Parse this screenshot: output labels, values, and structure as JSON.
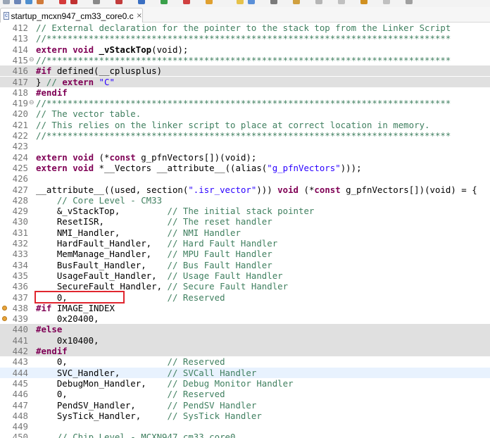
{
  "tab": {
    "label": "startup_mcxn947_cm33_core0.c",
    "close": "×"
  },
  "lines": [
    {
      "n": "412",
      "segs": [
        [
          "cm",
          "// External declaration for the pointer to the stack top from the Linker Script"
        ]
      ]
    },
    {
      "n": "413",
      "segs": [
        [
          "cm",
          "//*****************************************************************************"
        ]
      ]
    },
    {
      "n": "414",
      "segs": [
        [
          "kw",
          "extern void "
        ],
        [
          "fn",
          "_vStackTop"
        ],
        [
          "",
          "(void);"
        ]
      ]
    },
    {
      "n": "415",
      "fold": "⊖",
      "segs": [
        [
          "cm",
          "//*****************************************************************************"
        ]
      ]
    },
    {
      "n": "416",
      "bg": "inactive",
      "segs": [
        [
          "pp",
          "#if "
        ],
        [
          "",
          "defined(__cplusplus)"
        ]
      ]
    },
    {
      "n": "417",
      "bg": "inactive",
      "segs": [
        [
          "",
          "} "
        ],
        [
          "cm",
          "// "
        ],
        [
          "kw",
          "extern "
        ],
        [
          "str",
          "\"C\""
        ]
      ]
    },
    {
      "n": "418",
      "segs": [
        [
          "pp",
          "#endif"
        ]
      ]
    },
    {
      "n": "419",
      "fold": "⊖",
      "segs": [
        [
          "cm",
          "//*****************************************************************************"
        ]
      ]
    },
    {
      "n": "420",
      "segs": [
        [
          "cm",
          "// The vector table."
        ]
      ]
    },
    {
      "n": "421",
      "segs": [
        [
          "cm",
          "// This relies on the linker script to place at correct location in memory."
        ]
      ]
    },
    {
      "n": "422",
      "segs": [
        [
          "cm",
          "//*****************************************************************************"
        ]
      ]
    },
    {
      "n": "423",
      "segs": []
    },
    {
      "n": "424",
      "segs": [
        [
          "kw",
          "extern void "
        ],
        [
          "",
          "(*"
        ],
        [
          "kw",
          "const "
        ],
        [
          "",
          "g_pfnVectors[])(void);"
        ]
      ]
    },
    {
      "n": "425",
      "segs": [
        [
          "kw",
          "extern void "
        ],
        [
          "",
          "*__Vectors __attribute__((alias("
        ],
        [
          "str",
          "\"g_pfnVectors\""
        ],
        [
          "",
          ")));"
        ]
      ]
    },
    {
      "n": "426",
      "segs": []
    },
    {
      "n": "427",
      "segs": [
        [
          "",
          "__attribute__((used, section("
        ],
        [
          "str",
          "\".isr_vector\""
        ],
        [
          "",
          ")))"
        ],
        [
          "kw",
          " void "
        ],
        [
          "",
          "(*"
        ],
        [
          "kw",
          "const "
        ],
        [
          "",
          "g_pfnVectors[])(void) = {"
        ]
      ]
    },
    {
      "n": "428",
      "segs": [
        [
          "",
          "    "
        ],
        [
          "cm",
          "// Core Level - CM33"
        ]
      ]
    },
    {
      "n": "429",
      "segs": [
        [
          "",
          "    &_vStackTop,         "
        ],
        [
          "cm",
          "// The initial stack pointer"
        ]
      ]
    },
    {
      "n": "430",
      "segs": [
        [
          "",
          "    ResetISR,            "
        ],
        [
          "cm",
          "// The reset handler"
        ]
      ]
    },
    {
      "n": "431",
      "segs": [
        [
          "",
          "    NMI_Handler,         "
        ],
        [
          "cm",
          "// NMI Handler"
        ]
      ]
    },
    {
      "n": "432",
      "segs": [
        [
          "",
          "    HardFault_Handler,   "
        ],
        [
          "cm",
          "// Hard Fault Handler"
        ]
      ]
    },
    {
      "n": "433",
      "segs": [
        [
          "",
          "    MemManage_Handler,   "
        ],
        [
          "cm",
          "// MPU Fault Handler"
        ]
      ]
    },
    {
      "n": "434",
      "segs": [
        [
          "",
          "    BusFault_Handler,    "
        ],
        [
          "cm",
          "// Bus Fault Handler"
        ]
      ]
    },
    {
      "n": "435",
      "segs": [
        [
          "",
          "    UsageFault_Handler,  "
        ],
        [
          "cm",
          "// Usage Fault Handler"
        ]
      ]
    },
    {
      "n": "436",
      "segs": [
        [
          "",
          "    SecureFault_Handler, "
        ],
        [
          "cm",
          "// Secure Fault Handler"
        ]
      ]
    },
    {
      "n": "437",
      "segs": [
        [
          "",
          "    0,                   "
        ],
        [
          "cm",
          "// Reserved"
        ]
      ]
    },
    {
      "n": "438",
      "warn": true,
      "segs": [
        [
          "pp",
          "#if "
        ],
        [
          "",
          "IMAGE_INDEX"
        ]
      ]
    },
    {
      "n": "439",
      "warn": true,
      "segs": [
        [
          "",
          "    0x20400,"
        ]
      ]
    },
    {
      "n": "440",
      "bg": "inactive",
      "segs": [
        [
          "pp",
          "#else"
        ]
      ]
    },
    {
      "n": "441",
      "bg": "inactive",
      "segs": [
        [
          "",
          "    0x10400,"
        ]
      ]
    },
    {
      "n": "442",
      "bg": "inactive",
      "segs": [
        [
          "pp",
          "#endif"
        ]
      ]
    },
    {
      "n": "443",
      "segs": [
        [
          "",
          "    0,                   "
        ],
        [
          "cm",
          "// Reserved"
        ]
      ]
    },
    {
      "n": "444",
      "bg": "hl",
      "segs": [
        [
          "",
          "    SVC_Handler,         "
        ],
        [
          "cm",
          "// SVCall Handler"
        ]
      ]
    },
    {
      "n": "445",
      "segs": [
        [
          "",
          "    DebugMon_Handler,    "
        ],
        [
          "cm",
          "// Debug Monitor Handler"
        ]
      ]
    },
    {
      "n": "446",
      "segs": [
        [
          "",
          "    0,                   "
        ],
        [
          "cm",
          "// Reserved"
        ]
      ]
    },
    {
      "n": "447",
      "segs": [
        [
          "",
          "    PendSV_Handler,      "
        ],
        [
          "cm",
          "// PendSV Handler"
        ]
      ]
    },
    {
      "n": "448",
      "segs": [
        [
          "",
          "    SysTick_Handler,     "
        ],
        [
          "cm",
          "// SysTick Handler"
        ]
      ]
    },
    {
      "n": "449",
      "segs": []
    },
    {
      "n": "450",
      "segs": [
        [
          "",
          "    "
        ],
        [
          "cm",
          "// Chip Level - MCXN947_cm33_core0"
        ]
      ]
    }
  ]
}
